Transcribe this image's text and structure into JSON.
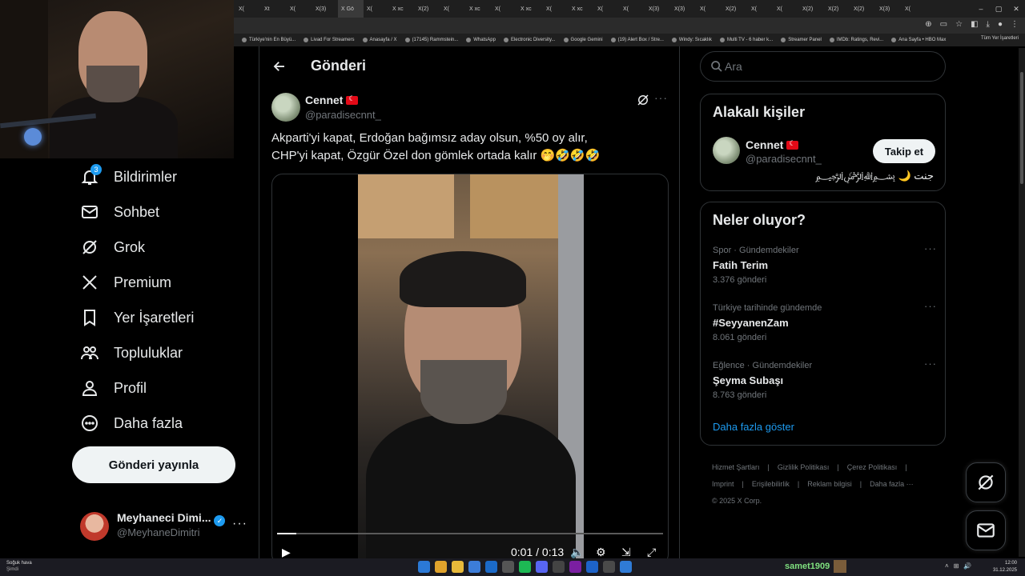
{
  "browser": {
    "tabs": [
      "X(",
      "Xt",
      "X(",
      "X(3)",
      "X Gö",
      "X(",
      "X xc",
      "X(2)",
      "X(",
      "X xc",
      "X(",
      "X xc",
      "X(",
      "X xc",
      "X(",
      "X(",
      "X(3)",
      "X(3)",
      "X(",
      "X(2)",
      "X(",
      "X(",
      "X(2)",
      "X(2)",
      "X(2)",
      "X(3)",
      "X("
    ],
    "bookmarks": [
      "Türkiye'nin En Büyü...",
      "Livad For Streamers",
      "Anasayfa / X",
      "(17145) Rammstein...",
      "WhatsApp",
      "Electronic Diversity...",
      "Google Gemini",
      "(19) Alert Box / Stre...",
      "Windy: Sıcaklık",
      "Multi TV - 6 haber k...",
      "Streamer Panel",
      "IMDb: Ratings, Revi...",
      "Ana Sayfa • HBO Max"
    ],
    "all_bookmarks": "Tüm Yer İşaretleri"
  },
  "nav": {
    "notifications": "Bildirimler",
    "notifications_badge": "3",
    "chat": "Sohbet",
    "grok": "Grok",
    "premium": "Premium",
    "bookmarks": "Yer İşaretleri",
    "communities": "Topluluklar",
    "profile": "Profil",
    "more": "Daha fazla",
    "post_button": "Gönderi yayınla",
    "account_name": "Meyhaneci Dimi...",
    "account_handle": "@MeyhaneDimitri",
    "account_more": "···"
  },
  "main": {
    "title": "Gönderi",
    "tweet": {
      "name": "Cennet",
      "handle": "@paradisecnnt_",
      "text_line1": "Akparti'yi kapat, Erdoğan bağımsız aday olsun, %50 oy alır,",
      "text_line2": "CHP'yi kapat, Özgür Özel don gömlek ortada kalır 🤭🤣🤣🤣",
      "more": "···",
      "video": {
        "time": "0:01 / 0:13",
        "progress_fraction": 0.05
      }
    }
  },
  "search": {
    "placeholder": "Ara"
  },
  "related": {
    "title": "Alakalı kişiler",
    "name": "Cennet",
    "handle": "@paradisecnnt_",
    "follow": "Takip et",
    "bio": "جنت 🌙 ﷽"
  },
  "trends": {
    "title": "Neler oluyor?",
    "items": [
      {
        "category": "Spor · Gündemdekiler",
        "topic": "Fatih Terim",
        "count": "3.376 gönderi",
        "more": "···"
      },
      {
        "category": "Türkiye tarihinde gündemde",
        "topic": "#SeyyanenZam",
        "count": "8.061 gönderi",
        "more": "···"
      },
      {
        "category": "Eğlence · Gündemdekiler",
        "topic": "Şeyma Subaşı",
        "count": "8.763 gönderi",
        "more": "···"
      }
    ],
    "show_more": "Daha fazla göster"
  },
  "footer": {
    "links_row1": [
      "Hizmet Şartları",
      "|",
      "Gizlilik Politikası",
      "|",
      "Çerez Politikası",
      "|"
    ],
    "links_row2": [
      "Imprint",
      "|",
      "Erişilebilirlik",
      "|",
      "Reklam bilgisi",
      "|",
      "Daha fazla ···"
    ],
    "copyright": "© 2025 X Corp."
  },
  "taskbar": {
    "weather_line1": "Soğuk hava",
    "weather_line2": "Şimdi",
    "username": "samet1909",
    "time": "12:00",
    "date": "31.12.2025"
  },
  "colors": {
    "accent": "#1d9bf0",
    "background": "#000000",
    "border": "#2f3336",
    "muted": "#71767b"
  }
}
